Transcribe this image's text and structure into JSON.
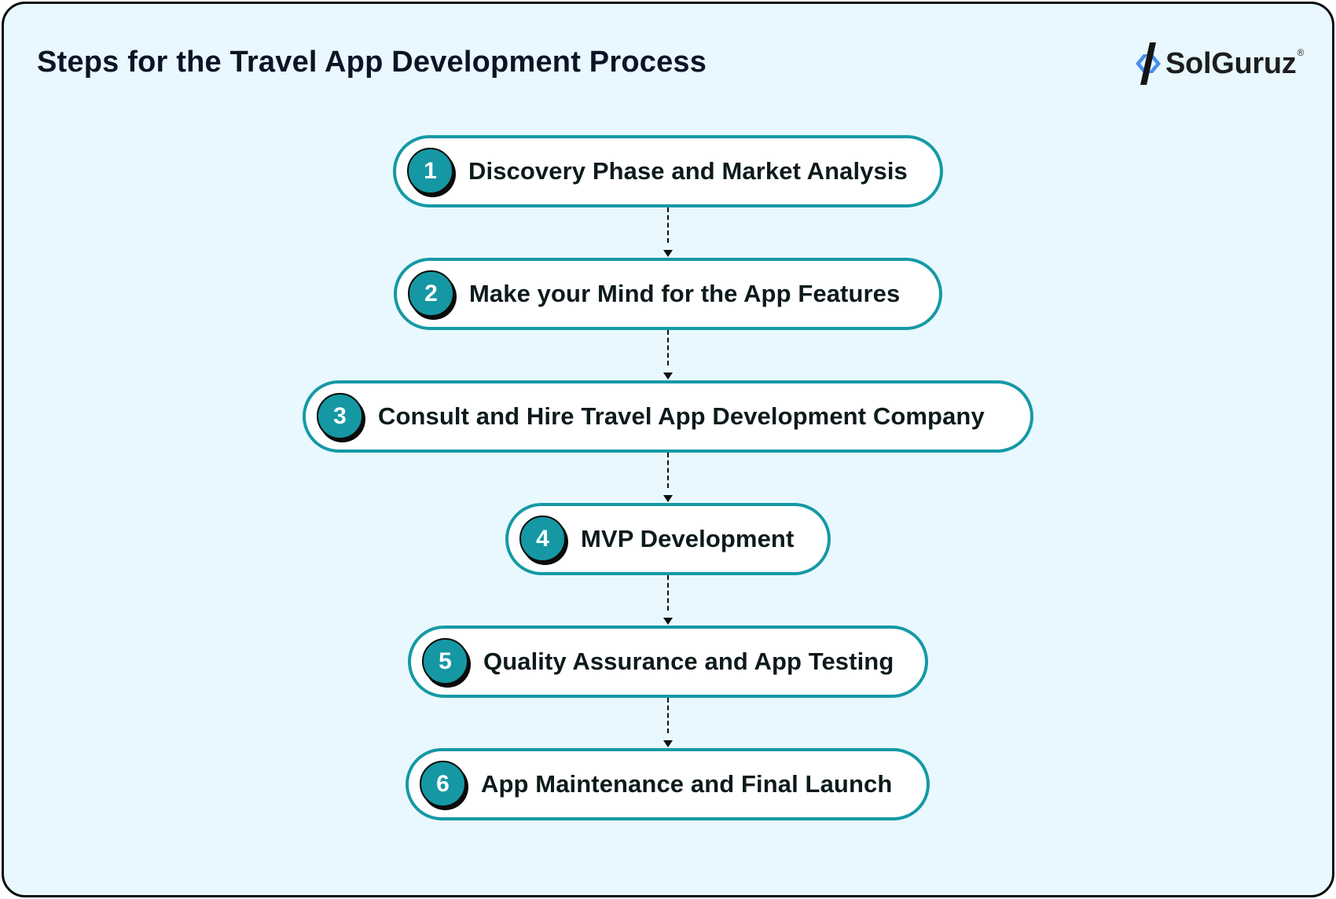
{
  "header": {
    "title": "Steps for the Travel App Development Process",
    "logo": {
      "icon": "solguruz-mark-icon",
      "text": "SolGuruz",
      "registered": "®"
    }
  },
  "colors": {
    "background": "#e8f8fe",
    "accent_teal": "#1599a5",
    "text_dark": "#0b1426",
    "logo_blue": "#4a8ef0"
  },
  "steps": [
    {
      "number": "1",
      "label": "Discovery Phase and Market Analysis"
    },
    {
      "number": "2",
      "label": "Make your Mind for the App Features"
    },
    {
      "number": "3",
      "label": "Consult and Hire Travel App Development Company"
    },
    {
      "number": "4",
      "label": "MVP Development"
    },
    {
      "number": "5",
      "label": "Quality Assurance and App Testing"
    },
    {
      "number": "6",
      "label": "App Maintenance and Final Launch"
    }
  ]
}
